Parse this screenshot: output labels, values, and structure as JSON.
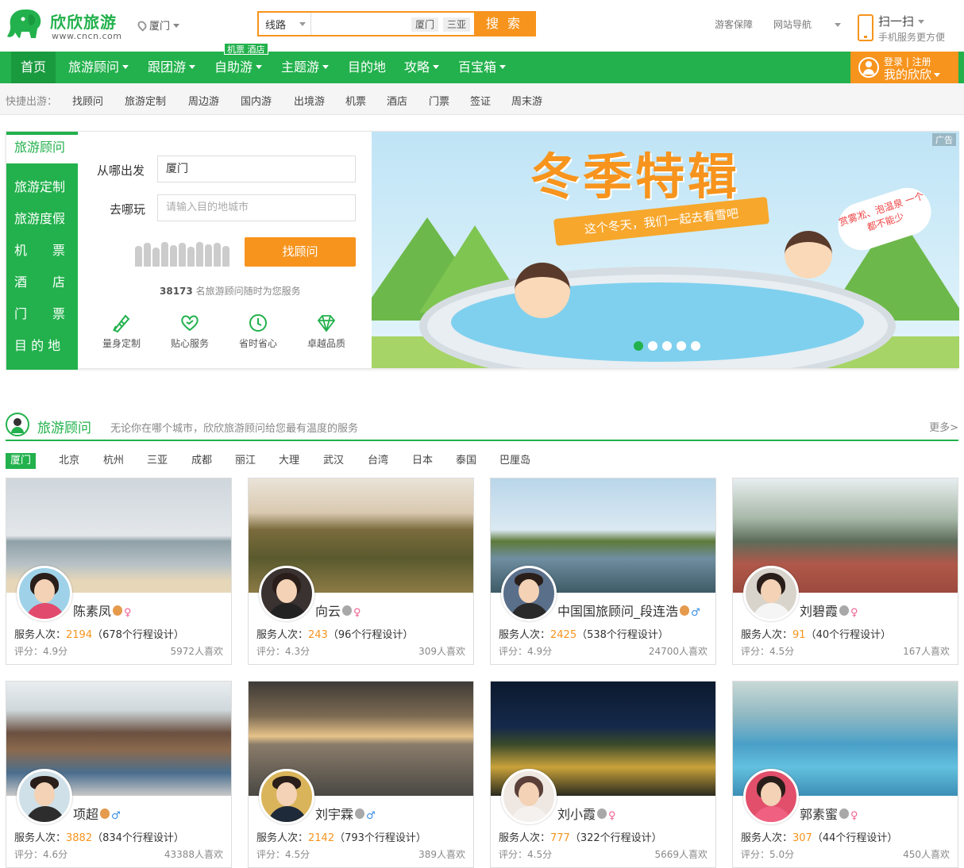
{
  "header": {
    "logo_name": "欣欣旅游",
    "logo_url": "www.cncn.com",
    "city": "厦门",
    "search": {
      "type": "线路",
      "placeholder": "",
      "hot": [
        "厦门",
        "三亚"
      ],
      "button": "搜 索"
    },
    "top_links": [
      "游客保障",
      "网站导航"
    ],
    "scan_title": "扫一扫",
    "scan_sub": "手机服务更方便"
  },
  "nav": {
    "items": [
      "首页",
      "旅游顾问",
      "跟团游",
      "自助游",
      "主题游",
      "目的地",
      "攻略",
      "百宝箱"
    ],
    "tag": "机票 酒店",
    "login": "登录 | 注册",
    "my": "我的欣欣"
  },
  "quick": {
    "label": "快捷出游：",
    "items": [
      "找顾问",
      "旅游定制",
      "周边游",
      "国内游",
      "出境游",
      "机票",
      "酒店",
      "门票",
      "签证",
      "周末游"
    ]
  },
  "hero": {
    "tabs": [
      "旅游顾问",
      "旅游定制",
      "旅游度假",
      "机　　票",
      "酒　　店",
      "门　　票",
      "目 的 地"
    ],
    "from_label": "从哪出发",
    "from_value": "厦门",
    "to_label": "去哪玩",
    "to_placeholder": "请输入目的地城市",
    "find_button": "找顾问",
    "count_num": "38173",
    "count_text": " 名旅游顾问随时为您服务",
    "features": [
      "量身定制",
      "贴心服务",
      "省时省心",
      "卓越品质"
    ],
    "banner": {
      "ad": "广告",
      "title": "冬季特辑",
      "ribbon": "这个冬天，我们一起去看雪吧",
      "cloud": "赏雾凇、泡温泉 一个都不能少"
    }
  },
  "guides": {
    "title": "旅游顾问",
    "subtitle": "无论你在哪个城市，欣欣旅游顾问给您最有温度的服务",
    "more": "更多>",
    "cities": [
      "厦门",
      "北京",
      "杭州",
      "三亚",
      "成都",
      "丽江",
      "大理",
      "武汉",
      "台湾",
      "日本",
      "泰国",
      "巴厘岛"
    ],
    "svc_label": "服务人次：",
    "cards": [
      {
        "name": "陈素凤",
        "sex": "♀",
        "served": "2194",
        "trips": "（678个行程设计）",
        "score": "评分：4.9分",
        "likes": "5972人喜欢"
      },
      {
        "name": "向云",
        "sex": "♀",
        "served": "243",
        "trips": "（96个行程设计）",
        "score": "评分：4.3分",
        "likes": "309人喜欢"
      },
      {
        "name": "中国国旅顾问_段连浩",
        "sex": "♂",
        "served": "2425",
        "trips": "（538个行程设计）",
        "score": "评分：4.9分",
        "likes": "24700人喜欢"
      },
      {
        "name": "刘碧霞",
        "sex": "♀",
        "served": "91",
        "trips": "（40个行程设计）",
        "score": "评分：4.5分",
        "likes": "167人喜欢"
      },
      {
        "name": "项超",
        "sex": "♂",
        "served": "3882",
        "trips": "（834个行程设计）",
        "score": "评分：4.6分",
        "likes": "43388人喜欢"
      },
      {
        "name": "刘宇霖",
        "sex": "♂",
        "served": "2142",
        "trips": "（793个行程设计）",
        "score": "评分：4.5分",
        "likes": "389人喜欢"
      },
      {
        "name": "刘小霞",
        "sex": "♀",
        "served": "777",
        "trips": "（322个行程设计）",
        "score": "评分：4.5分",
        "likes": "5669人喜欢"
      },
      {
        "name": "郭素蜜",
        "sex": "♀",
        "served": "307",
        "trips": "（44个行程设计）",
        "score": "评分：5.0分",
        "likes": "450人喜欢"
      }
    ]
  },
  "colors": {
    "brand_green": "#22b14c",
    "accent_orange": "#f7941d"
  }
}
